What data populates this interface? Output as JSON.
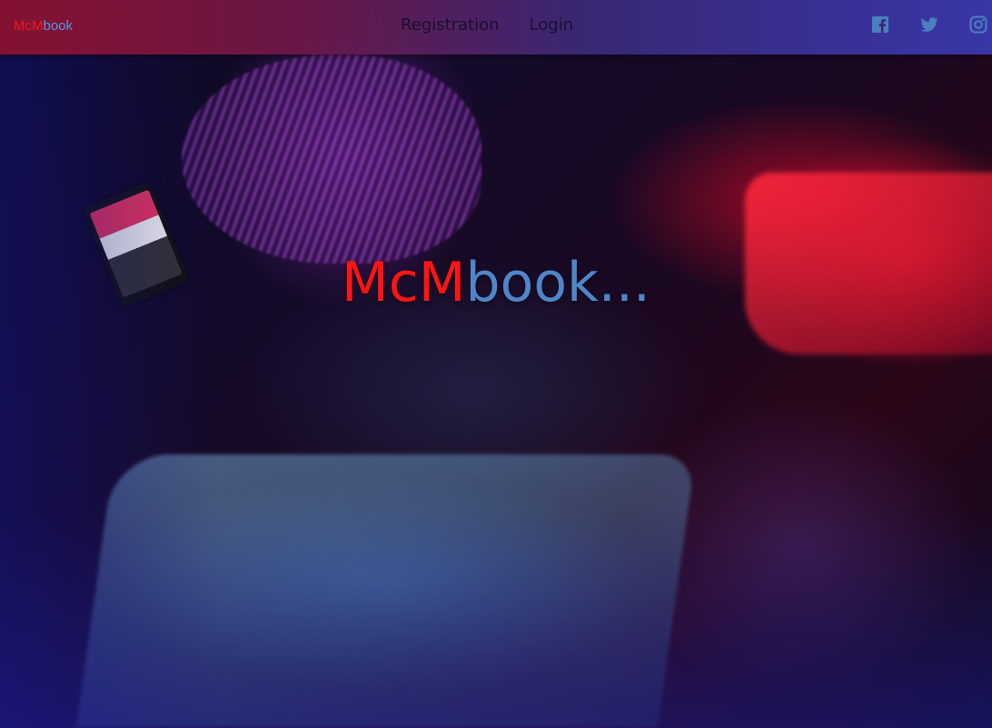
{
  "navbar": {
    "brand": {
      "part_a": "McM",
      "part_b": "book"
    },
    "links": [
      {
        "label": "Registration"
      },
      {
        "label": "Login"
      }
    ],
    "socials": [
      {
        "icon": "facebook-icon",
        "color": "#4e86c8"
      },
      {
        "icon": "twitter-icon",
        "color": "#4e86c8"
      },
      {
        "icon": "instagram-icon",
        "color": "#4e86c8"
      }
    ]
  },
  "hero": {
    "title_part_a": "McM",
    "title_part_b": "book...",
    "background": "photo-background"
  },
  "colors": {
    "accent_red": "#ff1414",
    "accent_blue": "#4e86c8",
    "nav_gradient_start": "#8c1230",
    "nav_gradient_end": "#3a3ab0"
  }
}
